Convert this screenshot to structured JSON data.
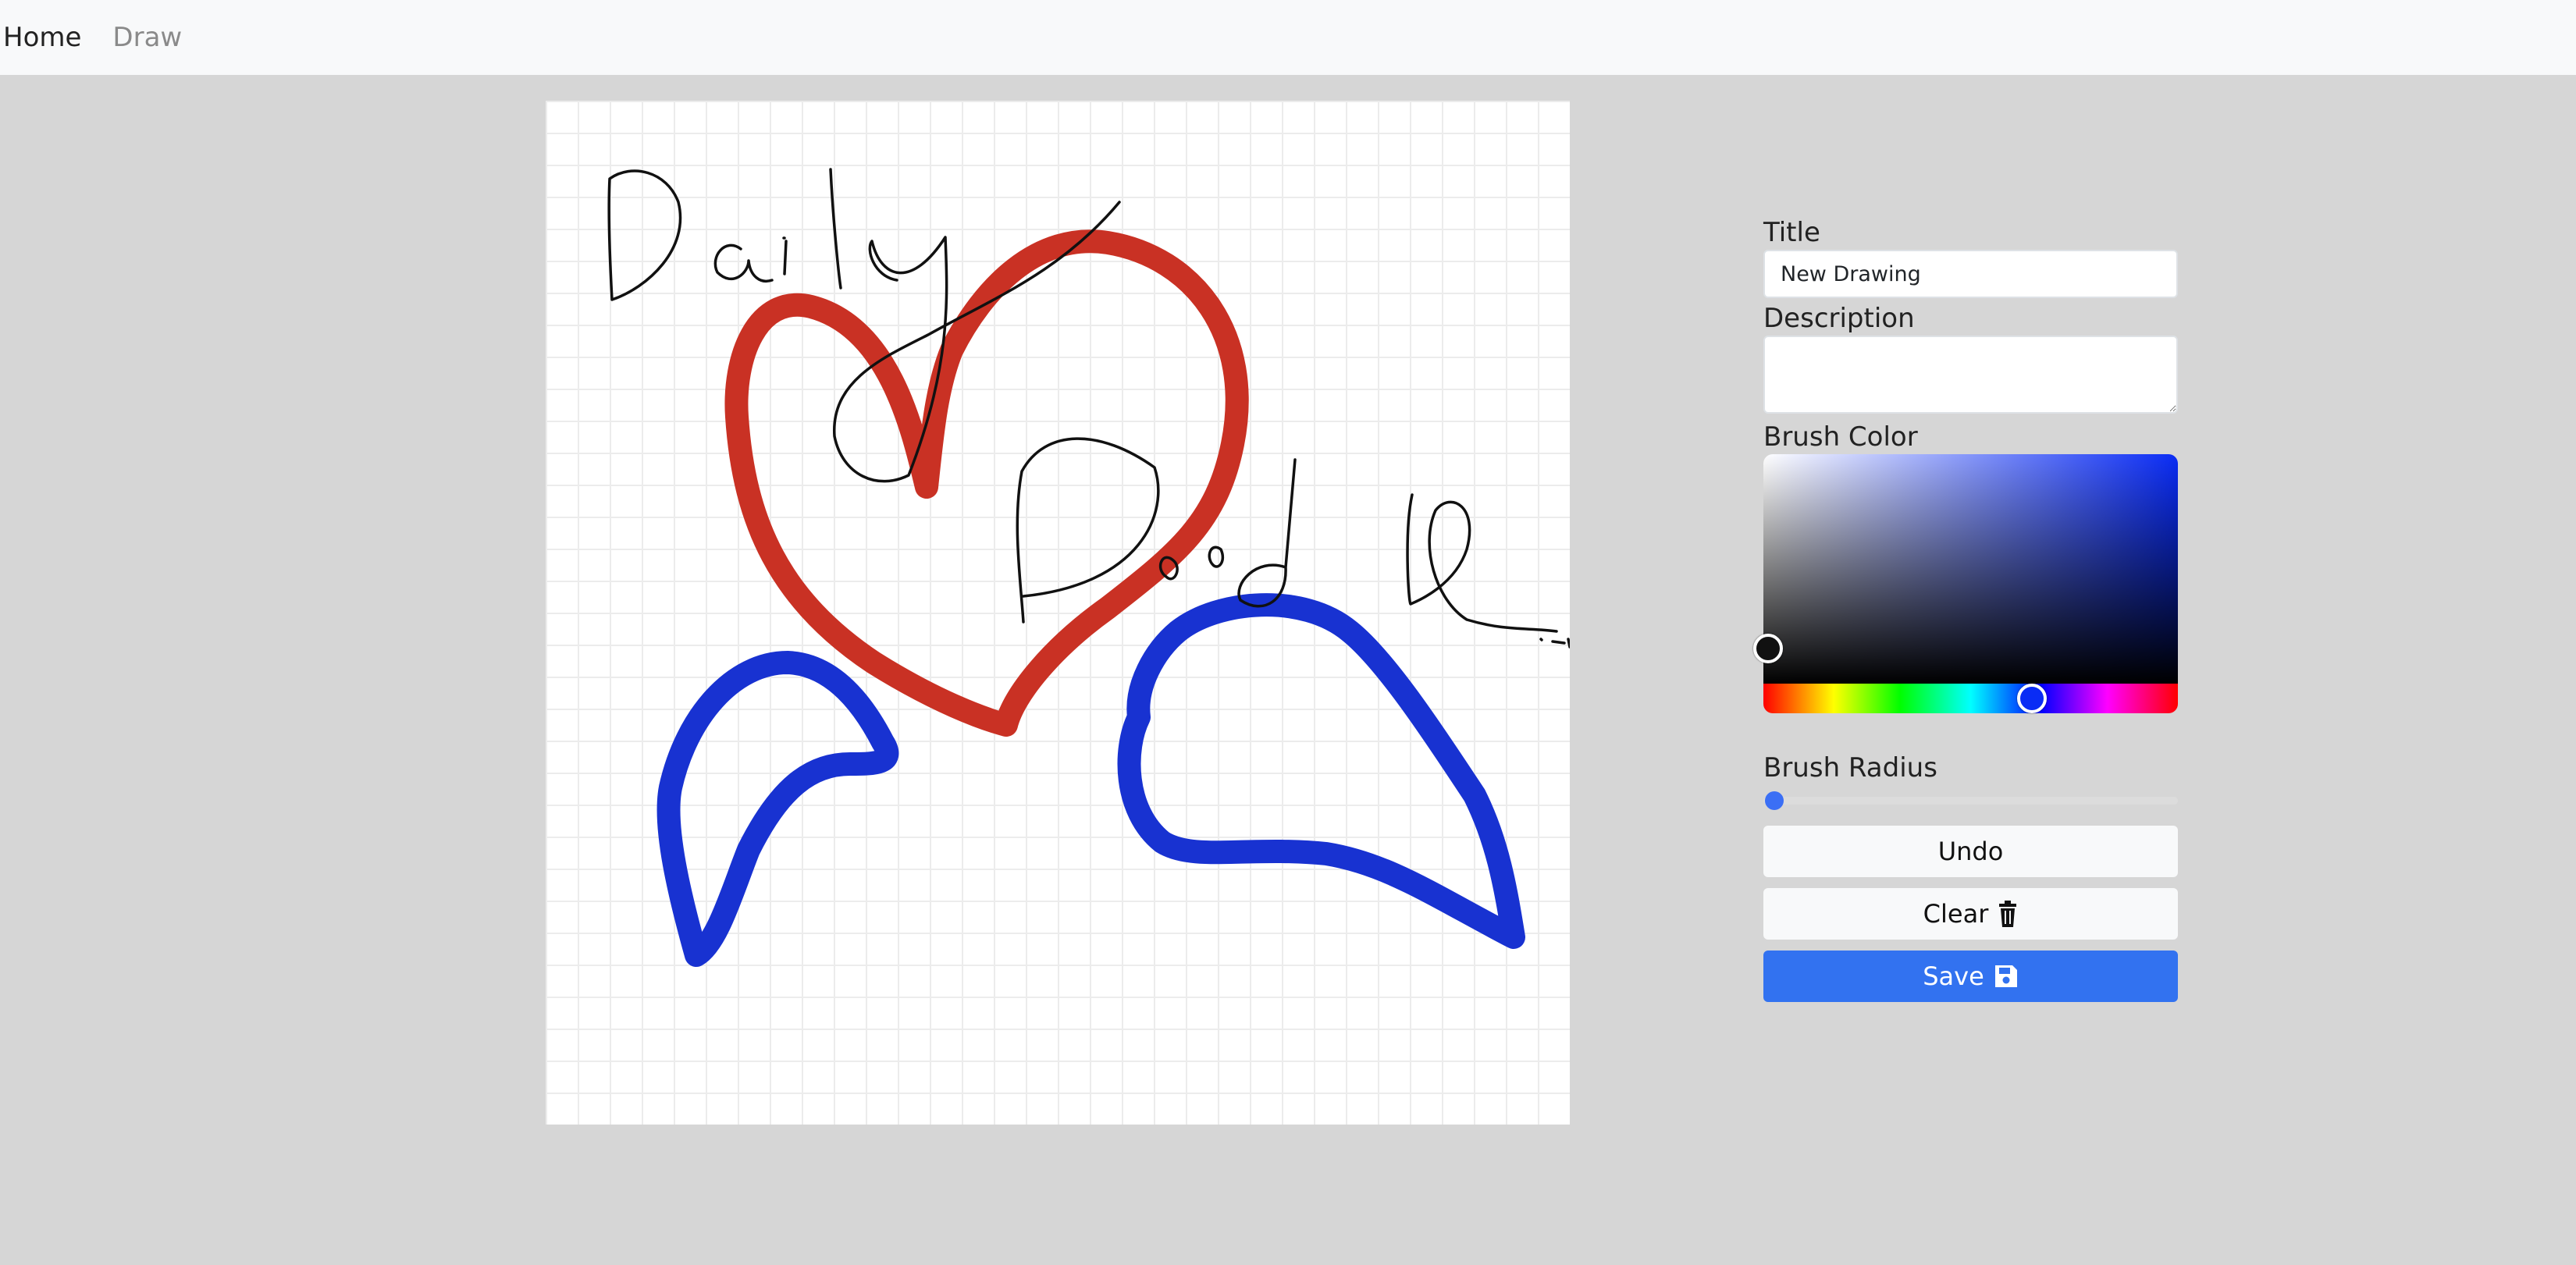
{
  "nav": {
    "home": "Home",
    "draw": "Draw"
  },
  "panel": {
    "title_label": "Title",
    "title_value": "New Drawing",
    "description_label": "Description",
    "description_value": "",
    "brush_color_label": "Brush Color",
    "brush_color_value": "#111111",
    "hue_color": "#0a2cf5",
    "brush_radius_label": "Brush Radius",
    "brush_radius_value": 0,
    "undo_label": "Undo",
    "clear_label": "Clear",
    "save_label": "Save"
  },
  "colors": {
    "navbar_bg": "#f8f9fa",
    "page_bg": "#d6d6d6",
    "primary": "#3272f0",
    "stroke_red": "#c93124",
    "stroke_magenta": "#c733b0",
    "stroke_blue": "#1832d1",
    "stroke_black": "#111111"
  },
  "icons": {
    "clear": "trash-icon",
    "save": "floppy-disk-icon"
  }
}
